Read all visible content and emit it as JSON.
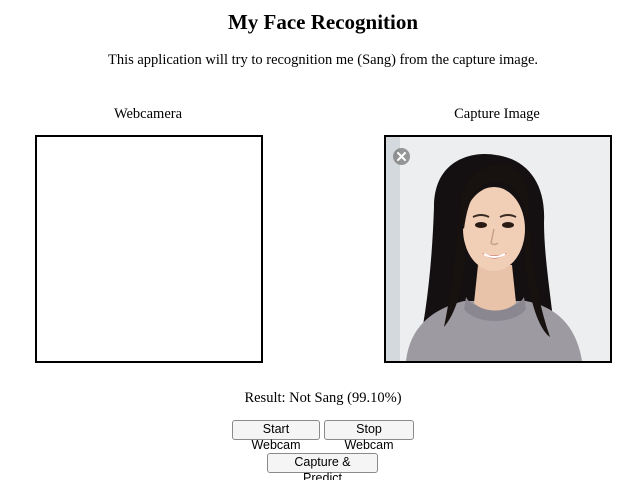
{
  "page": {
    "title": "My Face Recognition",
    "description": "This application will try to recognition me (Sang) from the capture image."
  },
  "panels": {
    "webcam_label": "Webcamera",
    "capture_label": "Capture Image"
  },
  "result": {
    "text": "Result: Not Sang (99.10%)"
  },
  "buttons": {
    "start_webcam": "Start Webcam",
    "stop_webcam": "Stop Webcam",
    "capture_predict": "Capture & Predict"
  },
  "icons": {
    "capture_overlay": "close-circle-icon"
  }
}
